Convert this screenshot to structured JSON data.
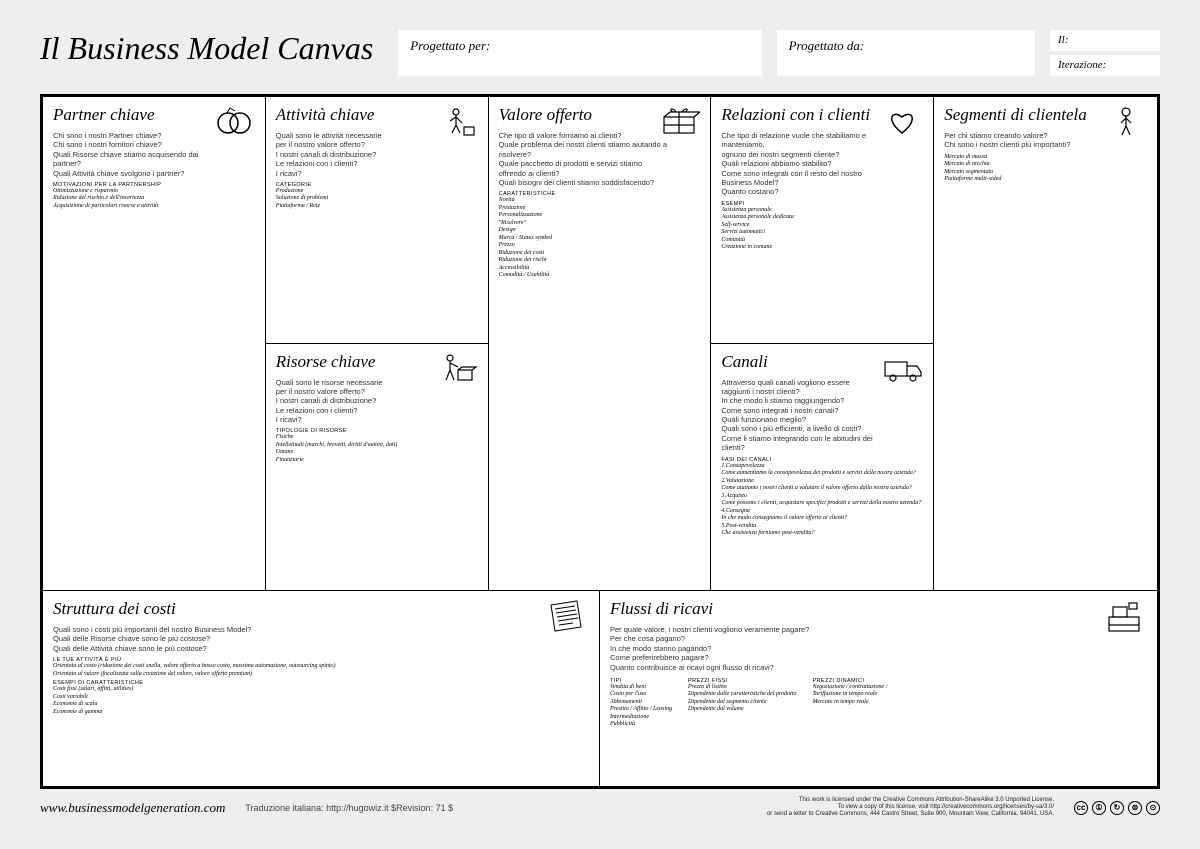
{
  "header": {
    "title": "Il Business Model Canvas",
    "designed_for_label": "Progettato per:",
    "designed_by_label": "Progettato da:",
    "date_label": "Il:",
    "iteration_label": "Iterazione:"
  },
  "blocks": {
    "partners": {
      "title": "Partner chiave",
      "questions": "Chi sono i nostri Partner chiave?\nChi sono i nostri fornitori chiave?\nQuali Risorse chiave stiamo acquisendo dai partner?\nQuali Attività chiave svolgono i partner?",
      "cat_title": "MOTIVAZIONI PER LA PARTNERSHIP",
      "cat_list": "Ottimizzazione e risparmio\nRiduzione del rischio e dell'incertezza\nAcquisizione di particolari risorse e attività"
    },
    "activities": {
      "title": "Attività chiave",
      "questions": "Quali sono le attività necessarie\nper il nostro valore offerto?\nI nostri canali di distribuzione?\nLe relazioni con i clienti?\nI ricavi?",
      "cat_title": "CATEGORIE",
      "cat_list": "Produzione\nSoluzione di problemi\nPiattaforma / Rete"
    },
    "value": {
      "title": "Valore offerto",
      "questions": "Che tipo di valore forniamo ai clienti?\nQuale problema dei nostri clienti stiamo aiutando a risolvere?\nQuale pacchetto di prodotti e servizi stiamo offrendo ai clienti?\nQuali bisogni dei clienti stiamo soddisfacendo?",
      "cat_title": "CARATTERISTICHE",
      "cat_list": "Novità\nPrestazioni\nPersonalizzazione\n\"Risolvere\"\nDesign\nMarca / Status symbol\nPrezzo\nRiduzione dei costi\nRiduzione dei rischi\nAccessibilità\nComodità / Usabilità"
    },
    "relationships": {
      "title": "Relazioni con i clienti",
      "questions": "Che tipo di relazione vuole che stabiliamo e manteniamo,\nognuno dei nostri segmenti cliente?\nQuali relazioni abbiamo stabilito?\nCome sono integrati con il resto del nostro Business Model?\nQuanto costano?",
      "cat_title": "ESEMPI",
      "cat_list": "Assistenza personale\nAssistenza personale dedicata\nSelf-service\nServizi automatici\nComunità\nCreazione in comune"
    },
    "segments": {
      "title": "Segmenti di clientela",
      "questions": "Per chi stiamo creando valore?\nChi sono i nostri clienti più importanti?",
      "cat_list": "Mercato di massa\nMercato di nicchia\nMercato segmentato\nPiattaforme multi-sided"
    },
    "resources": {
      "title": "Risorse chiave",
      "questions": "Quali sono le risorse necessarie\nper il nostro valore offerto?\nI nostri canali di distribuzione?\nLe relazioni con i clienti?\nI ricavi?",
      "cat_title": "TIPOLOGIE DI RISORSE",
      "cat_list": "Fisiche\nIntellettuali (marchi, brevetti, diritti d'autore, dati)\nUmane\nFinanziarie"
    },
    "channels": {
      "title": "Canali",
      "questions": "Attraverso quali canali vogliono essere\nraggiunti i nostri clienti?\nIn che modo li stiamo raggiungendo?\nCome sono integrati i nostri canali?\nQuali funzionano meglio?\nQuali sono i più efficienti, a livello di costi?\nCome li stiamo integrando con le abitudini dei clienti?",
      "cat_title": "FASI DEI CANALI",
      "cat_list": "1.Consapevolezza\nCome aumentiamo la consapevolezza dei prodotti e servizi della nostra azienda?\n2.Valutazione\nCome aiutiamo i nostri clienti a valutare il valore offerto dalla nostra azienda?\n3.Acquisto\nCome possono i clienti, acquistare specifici prodotti e servizi della nostra azienda?\n4.Consegna\nIn che modo consegnamo il valore offerto ai clienti?\n5.Post-vendita\nChe assistenza forniamo post-vendita?"
    },
    "costs": {
      "title": "Struttura dei costi",
      "questions": "Quali sono i costi più importanti del nostro Business Model?\nQuali delle Risorse chiave sono le più costose?\nQuali delle Attività chiave sono le più costose?",
      "cat_title1": "LE TUE ATTIVITÀ È PIÙ",
      "cat_list1": "Orientata al costo (riduzione dei costi snella, valore offerto a basso costo, massima automazione, outsourcing spinto)\nOrientata al valore (focalizzata sulla creazione del valore, valore offerto premium)",
      "cat_title2": "ESEMPI DI CARATTERISTICHE",
      "cat_list2": "Costi fissi (salari, affitti, utilities)\nCosti variabili\nEconomie di scala\nEconomie di gamma"
    },
    "revenue": {
      "title": "Flussi di ricavi",
      "questions": "Per quale valore, i nostri clienti vogliono veramente pagare?\nPer che cosa pagano?\nIn che modo stanno pagando?\nCome preferirebbero pagare?\nQuanto contribuisce ai ricavi ogni flusso di ricavi?",
      "cat_title_left": "TIPI",
      "cat_list_left": "Vendita di beni\nCosto per l'uso\nAbbonamenti\nPrestito / Affitto / Leasing\nIntermediazione\nPubblicità",
      "cat_title_right": "PREZZI FISSI",
      "cat_list_right": "Prezzo di listino\nDipendente dalle caratteristiche del prodotto\nDipendente dal segmento cliente\nDipendente dal volume",
      "cat_title_right2": "PREZZI DINAMICI",
      "cat_list_right2": "Negoziazione / contrattazione /\nTariffazione in tempo reale\nMercato in tempo reale"
    }
  },
  "footer": {
    "site": "www.businessmodelgeneration.com",
    "translation": "Traduzione italiana: http://hugowiz.it $Revision: 71 $",
    "license": "This work is licensed under the Creative Commons Attribution-ShareAlike 3.0 Unported License.\nTo view a copy of this license, visit http://creativecommons.org/licenses/by-sa/3.0/\nor send a letter to Creative Commons, 444 Castro Street, Suite 900, Mountain View, California, 94041, USA."
  }
}
